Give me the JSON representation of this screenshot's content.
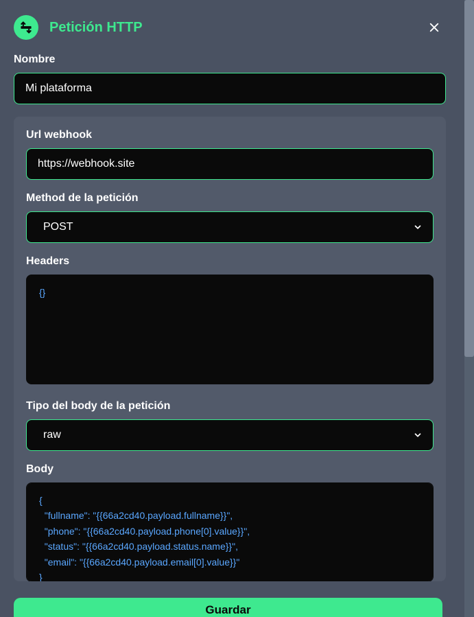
{
  "dialog": {
    "title": "Petición HTTP"
  },
  "name": {
    "label": "Nombre",
    "value": "Mi plataforma"
  },
  "webhook": {
    "label": "Url webhook",
    "value": "https://webhook.site"
  },
  "method": {
    "label": "Method de la petición",
    "value": "POST"
  },
  "headers": {
    "label": "Headers",
    "value": "{}"
  },
  "bodyType": {
    "label": "Tipo del body de la petición",
    "value": "raw"
  },
  "body": {
    "label": "Body",
    "value": "{\n  \"fullname\": \"{{66a2cd40.payload.fullname}}\",\n  \"phone\": \"{{66a2cd40.payload.phone[0].value}}\",\n  \"status\": \"{{66a2cd40.payload.status.name}}\",\n  \"email\": \"{{66a2cd40.payload.email[0].value}}\"\n}"
  },
  "save": {
    "label": "Guardar"
  }
}
